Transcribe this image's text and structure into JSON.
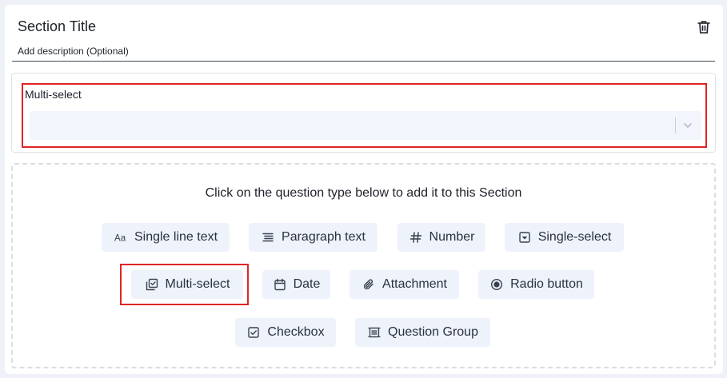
{
  "section": {
    "title": "Section Title",
    "description_placeholder": "Add description (Optional)"
  },
  "question": {
    "label": "Multi-select",
    "select_value": ""
  },
  "drop_zone": {
    "instruction": "Click on the question type below to add it to this Section"
  },
  "question_types": [
    {
      "label": "Single line text",
      "icon": "text-aa-icon"
    },
    {
      "label": "Paragraph text",
      "icon": "paragraph-lines-icon"
    },
    {
      "label": "Number",
      "icon": "hash-icon"
    },
    {
      "label": "Single-select",
      "icon": "dropdown-box-icon"
    },
    {
      "label": "Multi-select",
      "icon": "multi-select-icon"
    },
    {
      "label": "Date",
      "icon": "calendar-icon"
    },
    {
      "label": "Attachment",
      "icon": "paperclip-icon"
    },
    {
      "label": "Radio button",
      "icon": "radio-icon"
    },
    {
      "label": "Checkbox",
      "icon": "checkbox-icon"
    },
    {
      "label": "Question Group",
      "icon": "question-group-icon"
    }
  ],
  "colors": {
    "highlight": "#e02424",
    "chip_bg": "#eef2fb",
    "select_bg": "#f2f5fc",
    "page_bg": "#eef1f8"
  }
}
